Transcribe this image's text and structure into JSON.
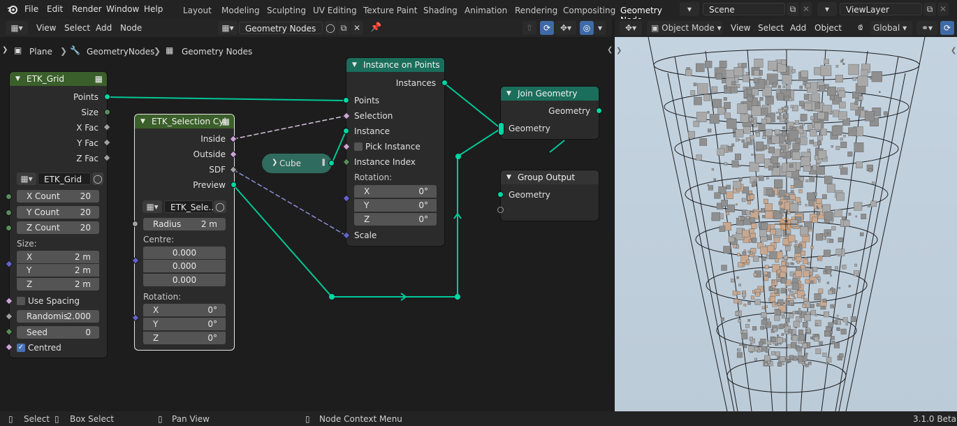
{
  "menu": [
    "File",
    "Edit",
    "Render",
    "Window",
    "Help"
  ],
  "workspaces": [
    "Layout",
    "Modeling",
    "Sculpting",
    "UV Editing",
    "Texture Paint",
    "Shading",
    "Animation",
    "Rendering",
    "Compositing",
    "Geometry Node"
  ],
  "scene": "Scene",
  "view_layer": "ViewLayer",
  "node_editor": {
    "header_menus": [
      "View",
      "Select",
      "Add",
      "Node"
    ],
    "tree_name": "Geometry Nodes",
    "breadcrumb": [
      "Plane",
      "GeometryNodes",
      "Geometry Nodes"
    ]
  },
  "viewport_header": {
    "mode": "Object Mode",
    "menus": [
      "View",
      "Select",
      "Add",
      "Object"
    ],
    "orientation": "Global"
  },
  "nodes": {
    "etk_grid": {
      "title": "ETK_Grid",
      "outputs": [
        "Points",
        "Size",
        "X Fac",
        "Y Fac",
        "Z Fac"
      ],
      "group_name": "ETK_Grid",
      "x_count_label": "X Count",
      "x_count": "20",
      "y_count_label": "Y Count",
      "y_count": "20",
      "z_count_label": "Z Count",
      "z_count": "20",
      "size_label": "Size:",
      "size_x_label": "X",
      "size_x": "2 m",
      "size_y_label": "Y",
      "size_y": "2 m",
      "size_z_label": "Z",
      "size_z": "2 m",
      "use_spacing": "Use Spacing",
      "randomis_label": "Randomis",
      "randomis": "2.000",
      "seed_label": "Seed",
      "seed": "0",
      "centred": "Centred"
    },
    "etk_selection": {
      "title": "ETK_Selection Cyl",
      "outputs": [
        "Inside",
        "Outside",
        "SDF",
        "Preview"
      ],
      "group_name": "ETK_Sele...",
      "radius_label": "Radius",
      "radius": "2 m",
      "centre_label": "Centre:",
      "centre": [
        "0.000",
        "0.000",
        "0.000"
      ],
      "rotation_label": "Rotation:",
      "rot_x_label": "X",
      "rot_x": "0°",
      "rot_y_label": "Y",
      "rot_y": "0°",
      "rot_z_label": "Z",
      "rot_z": "0°"
    },
    "cube": {
      "title": "Cube"
    },
    "instance_on_points": {
      "title": "Instance on Points",
      "output": "Instances",
      "inputs": [
        "Points",
        "Selection",
        "Instance",
        "Pick Instance",
        "Instance Index"
      ],
      "rotation_label": "Rotation:",
      "rot_x_label": "X",
      "rot_x": "0°",
      "rot_y_label": "Y",
      "rot_y": "0°",
      "rot_z_label": "Z",
      "rot_z": "0°",
      "scale": "Scale"
    },
    "join_geometry": {
      "title": "Join Geometry",
      "output": "Geometry",
      "input": "Geometry"
    },
    "group_output": {
      "title": "Group Output",
      "input": "Geometry"
    }
  },
  "status_bar": {
    "select": "Select",
    "box_select": "Box Select",
    "pan_view": "Pan View",
    "context_menu": "Node Context Menu",
    "version": "3.1.0 Beta"
  },
  "colors": {
    "geometry_socket": "#00d6a3",
    "group_node_header": "#3b5f2a",
    "geometry_node_header": "#1b6e5b",
    "boolean_socket": "#cca6d6",
    "vector_socket": "#6363c7",
    "accent_blue": "#4772b3"
  }
}
